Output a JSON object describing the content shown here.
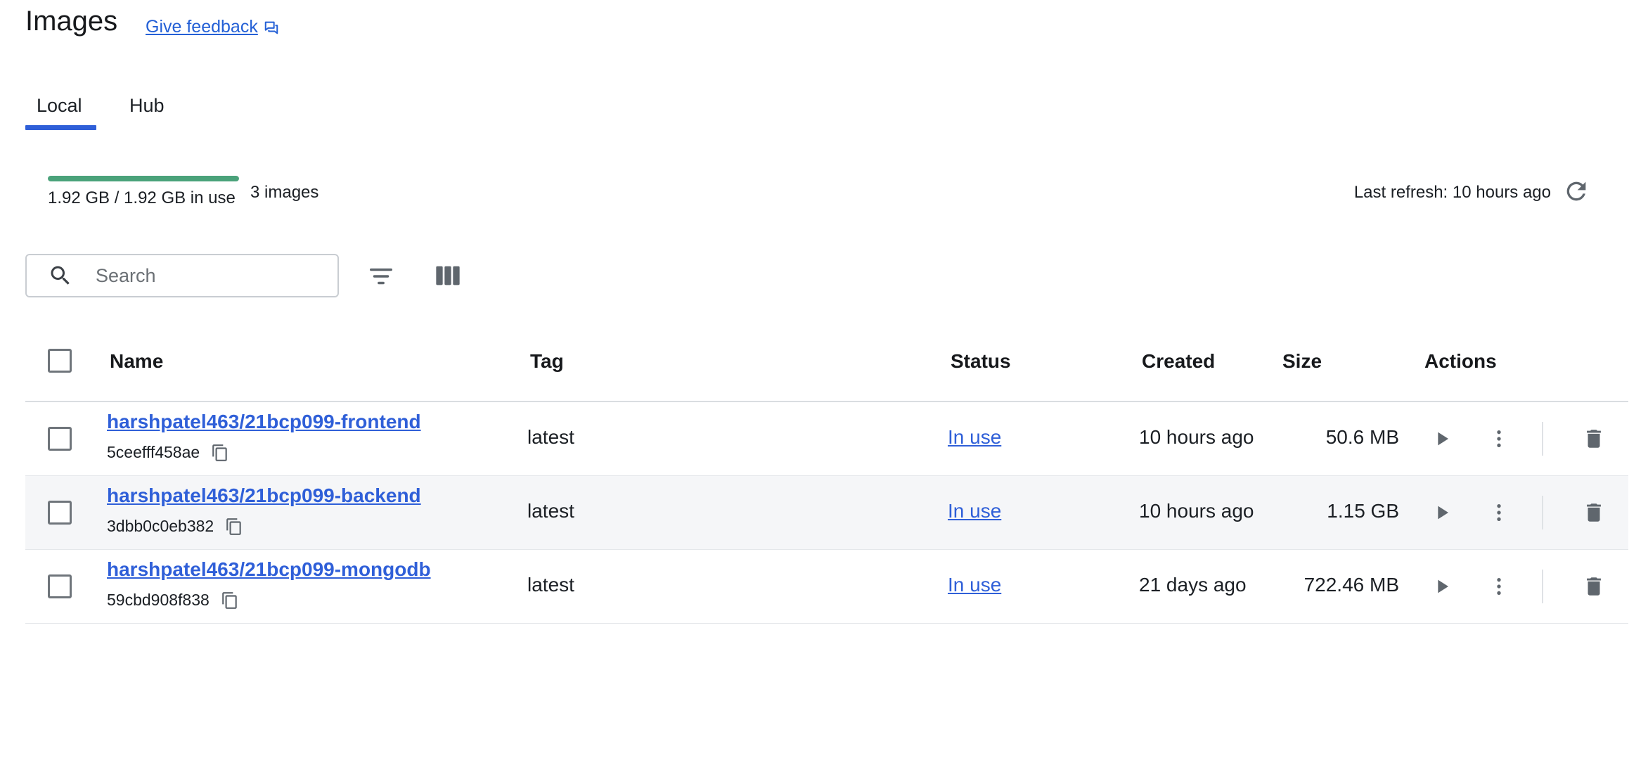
{
  "header": {
    "title": "Images",
    "feedback_label": "Give feedback"
  },
  "tabs": [
    {
      "label": "Local",
      "active": true
    },
    {
      "label": "Hub",
      "active": false
    }
  ],
  "usage": {
    "text": "1.92 GB / 1.92 GB in use",
    "fraction": 1.0,
    "bar_color": "#4aa27a",
    "images_count": "3 images",
    "last_refresh": "Last refresh: 10 hours ago"
  },
  "search": {
    "placeholder": "Search",
    "value": ""
  },
  "table": {
    "columns": {
      "name": "Name",
      "tag": "Tag",
      "status": "Status",
      "created": "Created",
      "size": "Size",
      "actions": "Actions"
    },
    "rows": [
      {
        "name": "harshpatel463/21bcp099-frontend",
        "id": "5ceefff458ae",
        "tag": "latest",
        "status": "In use",
        "created": "10 hours ago",
        "size": "50.6 MB"
      },
      {
        "name": "harshpatel463/21bcp099-backend",
        "id": "3dbb0c0eb382",
        "tag": "latest",
        "status": "In use",
        "created": "10 hours ago",
        "size": "1.15 GB"
      },
      {
        "name": "harshpatel463/21bcp099-mongodb",
        "id": "59cbd908f838",
        "tag": "latest",
        "status": "In use",
        "created": "21 days ago",
        "size": "722.46 MB"
      }
    ]
  },
  "colors": {
    "accent": "#2f5fd8",
    "link": "#2460d6",
    "icon": "#5f666d"
  },
  "icons": [
    "feedback-icon",
    "refresh-icon",
    "search-icon",
    "filter-icon",
    "columns-icon",
    "copy-icon",
    "play-icon",
    "more-vertical-icon",
    "trash-icon"
  ]
}
